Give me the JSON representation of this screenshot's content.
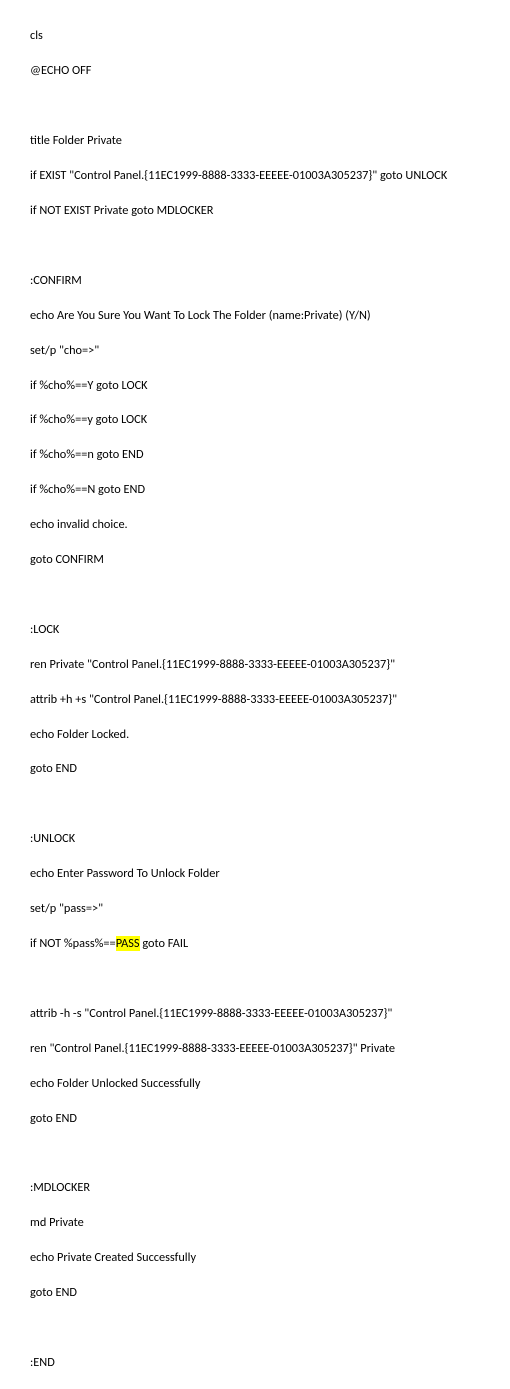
{
  "code": {
    "l1": "cls",
    "l2": "@ECHO OFF",
    "l3": "title Folder Private",
    "l4": "if EXIST \"Control Panel.{11EC1999-8888-3333-EEEEE-01003A305237}\" goto UNLOCK",
    "l5": "if NOT EXIST Private goto MDLOCKER",
    "l6": ":CONFIRM",
    "l7": "echo Are You Sure You Want To Lock The Folder (name:Private) (Y/N)",
    "l8": "set/p \"cho=>\"",
    "l9": "if %cho%==Y goto LOCK",
    "l10": "if %cho%==y goto LOCK",
    "l11": "if %cho%==n goto END",
    "l12": "if %cho%==N goto END",
    "l13": "echo invalid choice.",
    "l14": "goto CONFIRM",
    "l15": ":LOCK",
    "l16": "ren Private \"Control Panel.{11EC1999-8888-3333-EEEEE-01003A305237}\"",
    "l17": "attrib +h +s \"Control Panel.{11EC1999-8888-3333-EEEEE-01003A305237}\"",
    "l18": "echo Folder Locked.",
    "l19": "goto END",
    "l20": ":UNLOCK",
    "l21": "echo Enter Password To Unlock Folder",
    "l22": "set/p \"pass=>\"",
    "l23a": "if NOT %pass%==",
    "l23b": "PASS",
    "l23c": " goto FAIL",
    "l24": "attrib -h -s \"Control Panel.{11EC1999-8888-3333-EEEEE-01003A305237}\"",
    "l25": "ren \"Control Panel.{11EC1999-8888-3333-EEEEE-01003A305237}\" Private",
    "l26": "echo Folder Unlocked Successfully",
    "l27": "goto END",
    "l28": ":MDLOCKER",
    "l29": "md Private",
    "l30": "echo Private Created Successfully",
    "l31": "goto END",
    "l32": ":END"
  }
}
